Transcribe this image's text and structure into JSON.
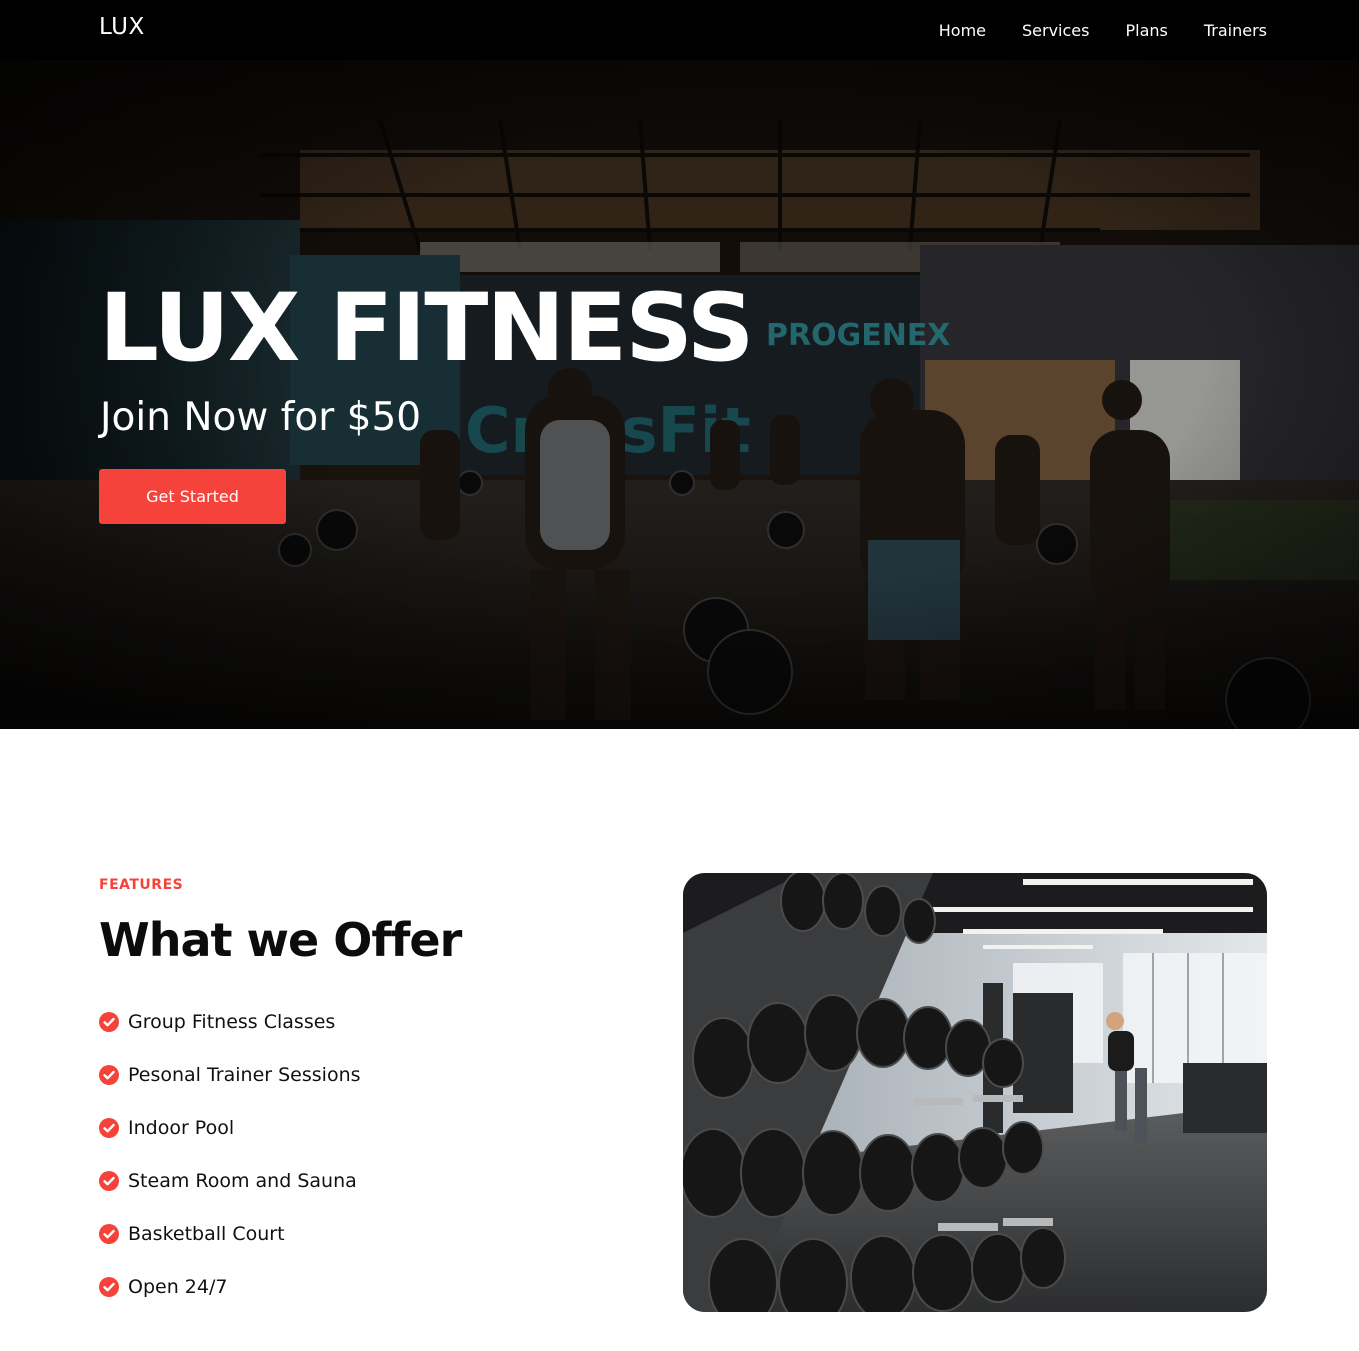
{
  "nav": {
    "logo": "LUX",
    "links": [
      "Home",
      "Services",
      "Plans",
      "Trainers"
    ]
  },
  "hero": {
    "title": "LUX FITNESS",
    "subtitle": "Join Now for $50",
    "cta_label": "Get Started"
  },
  "features": {
    "eyebrow": "FEATURES",
    "title": "What we Offer",
    "items": [
      "Group Fitness Classes",
      "Pesonal Trainer Sessions",
      "Indoor Pool",
      "Steam Room and Sauna",
      "Basketball Court",
      "Open 24/7"
    ]
  },
  "colors": {
    "accent": "#f5433b",
    "nav_bg": "#000000",
    "text": "#111111"
  },
  "icons": {
    "feature_check": "check-circle-icon"
  }
}
